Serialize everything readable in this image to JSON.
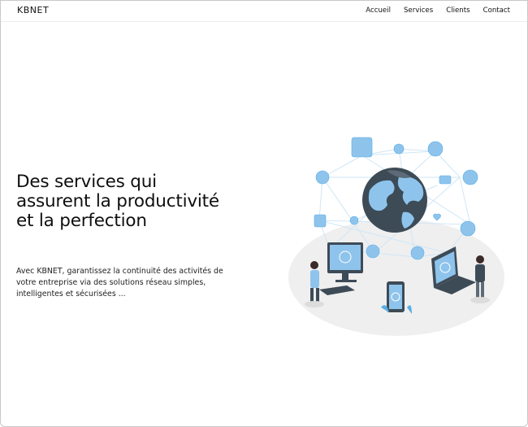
{
  "header": {
    "logo": "KBNET",
    "nav": [
      "Accueil",
      "Services",
      "Clients",
      "Contact"
    ]
  },
  "hero": {
    "title_lines": [
      "Des services qui",
      "assurent la productivité",
      "et la perfection"
    ],
    "description": "Avec KBNET, garantissez la continuité des activités de votre entreprise via des solutions réseau simples, intelligentes et sécurisées ...",
    "illustration": "network-globe-illustration"
  },
  "colors": {
    "accent_blue": "#5aaee6",
    "globe_dark": "#3d4b57",
    "globe_light": "#8ec4ec",
    "platform": "#efefef"
  }
}
